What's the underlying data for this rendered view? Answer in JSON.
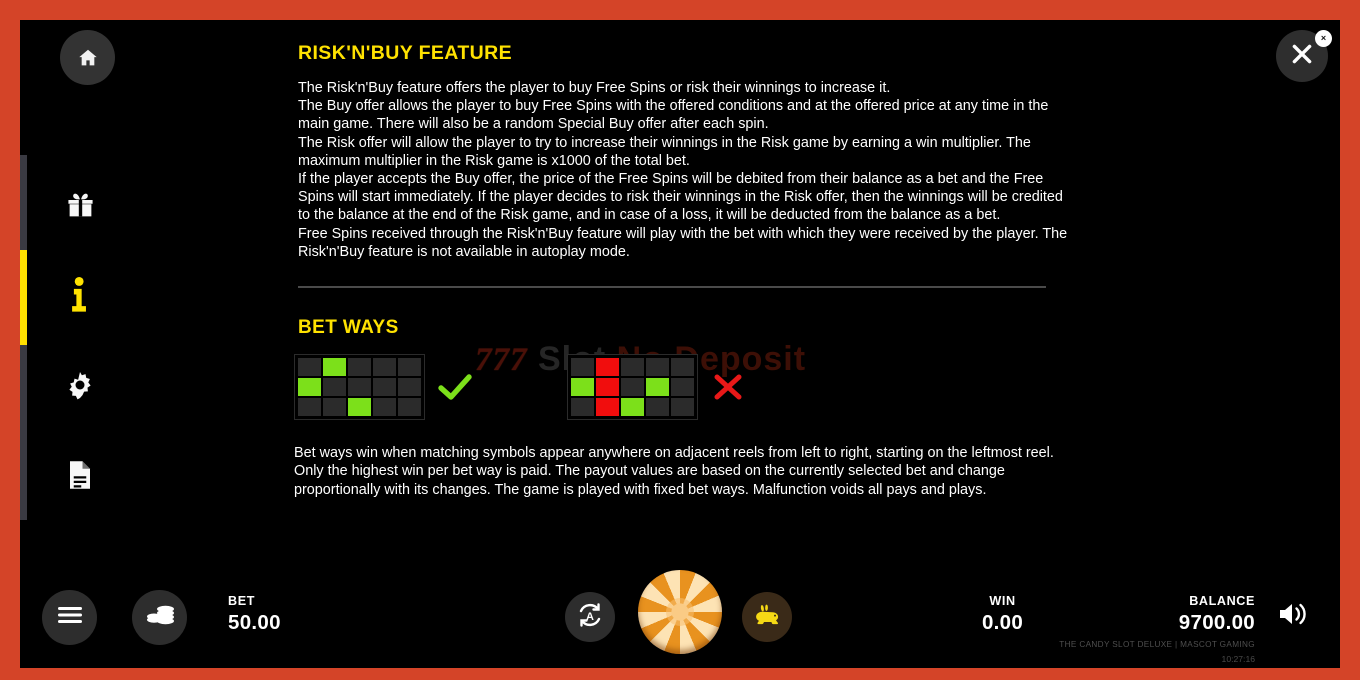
{
  "theme": {
    "frame_border": "#d44428",
    "background": "#000000",
    "accent_yellow": "#ffe200",
    "green_cell": "#7ce01a",
    "red_cell": "#f10d0d",
    "inactive_cell": "#2b2b2b"
  },
  "watermark": {
    "sevens": "777",
    "part_gray": "Slot",
    "part_red": "No Deposit"
  },
  "sidebar": {
    "items": [
      {
        "label": "Home",
        "icon": "home-icon",
        "active": false
      },
      {
        "label": "Bonus",
        "icon": "gift-icon",
        "active": false
      },
      {
        "label": "Info",
        "icon": "info-icon",
        "active": true
      },
      {
        "label": "Settings",
        "icon": "gear-icon",
        "active": false
      },
      {
        "label": "Rules",
        "icon": "document-icon",
        "active": false
      }
    ],
    "scrollbar": {
      "thumb_color": "#ffe000",
      "track_color": "#3a3a42"
    }
  },
  "close": {
    "icon": "close-icon",
    "badge_label": "×"
  },
  "main": {
    "title": "RISK'N'BUY FEATURE",
    "paragraph": "The Risk'n'Buy feature offers the player to buy Free Spins or risk their winnings to increase it.\nThe Buy offer allows the player to buy Free Spins with the offered conditions and at the offered price at any time in the main game. There will also be a random Special Buy offer after each spin.\nThe Risk offer will allow the player to try to increase their winnings in the Risk game by earning a win multiplier. The maximum multiplier in the Risk game is x1000 of the total bet.\nIf the player accepts the Buy offer, the price of the Free Spins will be debited from their balance as a bet and the Free Spins will start immediately. If the player decides to risk their winnings in the Risk offer, then the winnings will be credited to the balance at the end of the Risk game, and in case of a loss, it will be deducted from the balance as a bet.\nFree Spins received through the Risk'n'Buy feature will play with the bet with which they were received by the player. The Risk'n'Buy feature is not available in autoplay mode.",
    "subtitle": "BET WAYS",
    "paragraph2": "Bet ways win when matching symbols appear anywhere on adjacent reels from left to right, starting on the leftmost reel. Only the highest win per bet way is paid. The payout values are based on the currently selected bet and change proportionally with its changes. The game is played with fixed bet ways. Malfunction voids all pays and plays.",
    "bet_ways_examples": [
      {
        "name": "valid-bet-way",
        "mark": "check",
        "rows": 3,
        "cols": 5,
        "cells": [
          [
            "off",
            "green",
            "off",
            "off",
            "off"
          ],
          [
            "green",
            "off",
            "off",
            "off",
            "off"
          ],
          [
            "off",
            "off",
            "green",
            "off",
            "off"
          ]
        ]
      },
      {
        "name": "invalid-bet-way",
        "mark": "cross",
        "rows": 3,
        "cols": 5,
        "cells": [
          [
            "off",
            "red",
            "off",
            "off",
            "off"
          ],
          [
            "green",
            "red",
            "off",
            "green",
            "off"
          ],
          [
            "off",
            "red",
            "green",
            "off",
            "off"
          ]
        ]
      }
    ]
  },
  "bottom_bar": {
    "menu_icon": "hamburger-menu-icon",
    "bet_icon": "coin-stack-icon",
    "bet_label": "BET",
    "bet_value": "50.00",
    "autoplay_icon": "autoplay-icon",
    "spin_icon": "candy-spin-icon",
    "turbo_icon": "rabbit-turbo-icon",
    "win_label": "WIN",
    "win_value": "0.00",
    "balance_label": "BALANCE",
    "balance_value": "9700.00",
    "brand": "THE CANDY SLOT DELUXE | MASCOT GAMING",
    "clock": "10:27:16",
    "volume_icon": "volume-icon"
  }
}
